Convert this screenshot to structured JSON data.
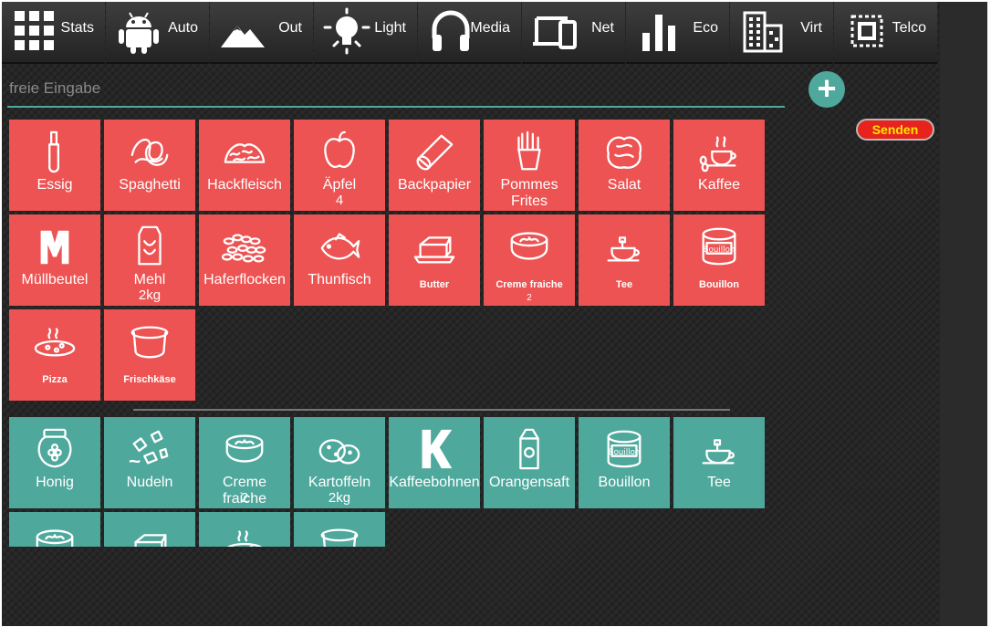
{
  "nav": [
    {
      "label": "Stats",
      "icon": "grid-icon"
    },
    {
      "label": "Auto",
      "icon": "android-icon"
    },
    {
      "label": "Out",
      "icon": "mountain-icon"
    },
    {
      "label": "Light",
      "icon": "lightbulb-icon"
    },
    {
      "label": "Media",
      "icon": "headphones-icon"
    },
    {
      "label": "Net",
      "icon": "devices-icon"
    },
    {
      "label": "Eco",
      "icon": "bar-chart-icon"
    },
    {
      "label": "Virt",
      "icon": "building-icon"
    },
    {
      "label": "Telco",
      "icon": "chip-icon"
    }
  ],
  "input": {
    "placeholder": "freie Eingabe",
    "value": ""
  },
  "add_label": "+",
  "send_label": "Senden",
  "colors": {
    "needed": "#ec5352",
    "have": "#4fa89c",
    "send": "#e8231e",
    "send_text": "#ffe400"
  },
  "needed": [
    {
      "label": "Essig",
      "qty": "",
      "small": false,
      "icon": "bottle-icon"
    },
    {
      "label": "Spaghetti",
      "qty": "",
      "small": false,
      "icon": "pasta-icon"
    },
    {
      "label": "Hackfleisch",
      "qty": "",
      "small": false,
      "icon": "minced-meat-icon"
    },
    {
      "label": "Äpfel",
      "qty": "4",
      "small": false,
      "icon": "apple-icon"
    },
    {
      "label": "Backpapier",
      "qty": "",
      "small": false,
      "icon": "paper-roll-icon"
    },
    {
      "label": "Pommes Frites",
      "qty": "",
      "small": false,
      "icon": "fries-icon"
    },
    {
      "label": "Salat",
      "qty": "",
      "small": false,
      "icon": "lettuce-icon"
    },
    {
      "label": "Kaffee",
      "qty": "",
      "small": false,
      "icon": "coffee-icon"
    },
    {
      "label": "Müllbeutel",
      "qty": "",
      "small": false,
      "icon": "trash-bag-icon"
    },
    {
      "label": "Mehl",
      "qty": "2kg",
      "small": false,
      "icon": "flour-bag-icon"
    },
    {
      "label": "Haferflocken",
      "qty": "",
      "small": false,
      "icon": "oats-icon"
    },
    {
      "label": "Thunfisch",
      "qty": "",
      "small": false,
      "icon": "fish-icon"
    },
    {
      "label": "Butter",
      "qty": "",
      "small": true,
      "icon": "butter-icon"
    },
    {
      "label": "Creme fraiche",
      "qty": "2",
      "small": true,
      "icon": "cream-cup-icon"
    },
    {
      "label": "Tee",
      "qty": "",
      "small": true,
      "icon": "tea-cup-icon"
    },
    {
      "label": "Bouillon",
      "qty": "",
      "small": true,
      "icon": "bouillon-jar-icon"
    },
    {
      "label": "Pizza",
      "qty": "",
      "small": true,
      "icon": "pizza-icon"
    },
    {
      "label": "Frischkäse",
      "qty": "",
      "small": true,
      "icon": "cream-cheese-icon"
    }
  ],
  "have": [
    {
      "label": "Honig",
      "qty": "",
      "small": false,
      "icon": "honey-jar-icon"
    },
    {
      "label": "Nudeln",
      "qty": "",
      "small": false,
      "icon": "noodles-icon"
    },
    {
      "label": "Creme fraiche",
      "qty": "2",
      "small": false,
      "icon": "cream-cup-icon"
    },
    {
      "label": "Kartoffeln",
      "qty": "2kg",
      "small": false,
      "icon": "potatoes-icon"
    },
    {
      "label": "Kaffeebohnen",
      "qty": "",
      "small": false,
      "icon": "k-logo-icon"
    },
    {
      "label": "Orangensaft",
      "qty": "",
      "small": false,
      "icon": "juice-carton-icon"
    },
    {
      "label": "Bouillon",
      "qty": "",
      "small": false,
      "icon": "bouillon-jar-icon"
    },
    {
      "label": "Tee",
      "qty": "",
      "small": false,
      "icon": "tea-cup-icon"
    },
    {
      "label": "",
      "qty": "",
      "small": false,
      "icon": "cream-cup-icon"
    },
    {
      "label": "",
      "qty": "",
      "small": false,
      "icon": "butter-icon"
    },
    {
      "label": "",
      "qty": "",
      "small": false,
      "icon": "pizza-icon"
    },
    {
      "label": "",
      "qty": "",
      "small": false,
      "icon": "cream-cheese-icon"
    }
  ]
}
